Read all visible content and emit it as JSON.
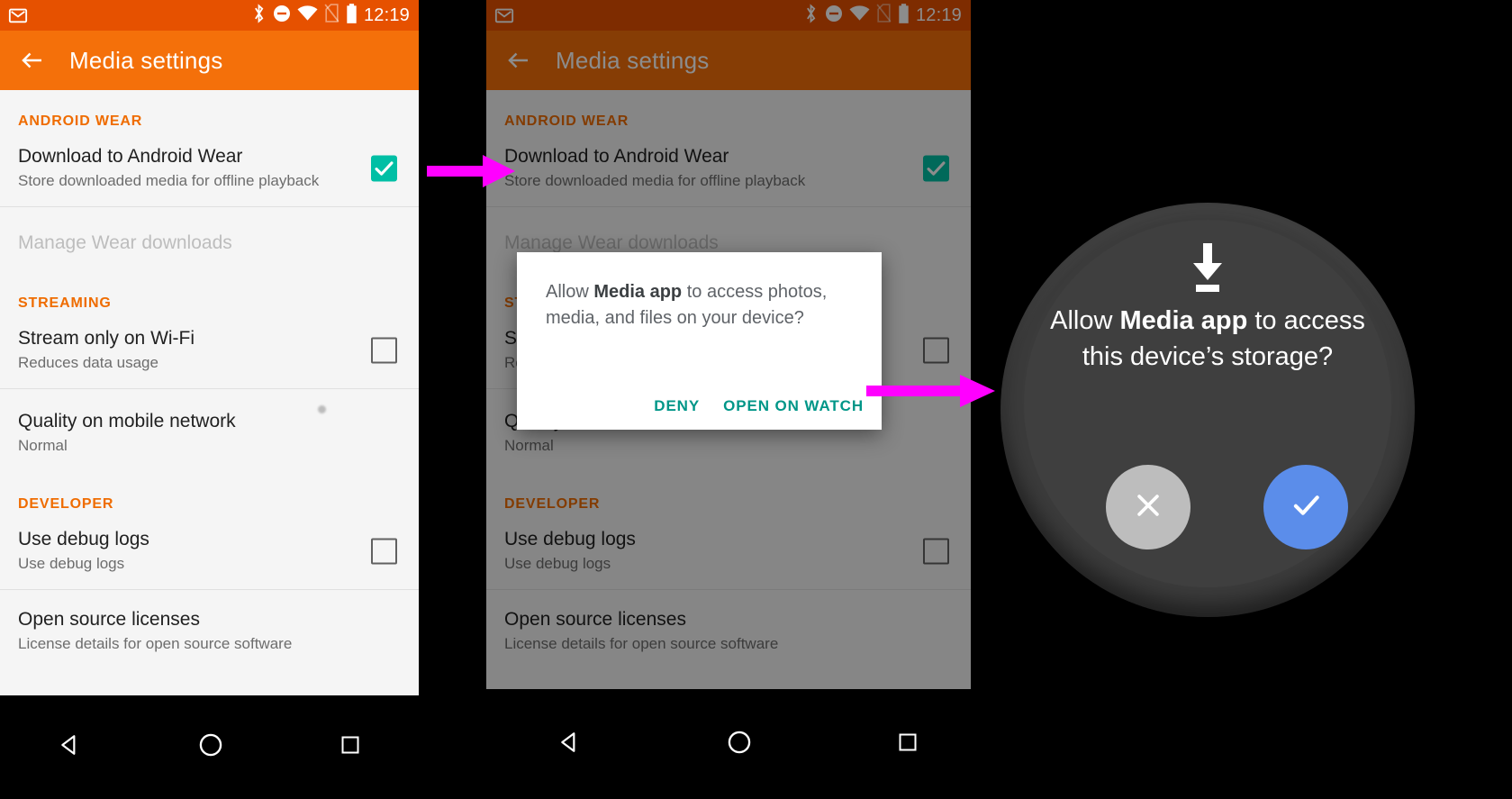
{
  "colors": {
    "status_bar": "#e65100",
    "app_bar": "#f4700a",
    "section_header": "#ef6c00",
    "checkbox_on": "#00bfa5",
    "dialog_action": "#009688",
    "arrow": "#ff00ff",
    "watch_allow": "#5b8dea",
    "watch_deny": "#bdbdbd"
  },
  "phone": {
    "status_bar": {
      "time": "12:19",
      "icons": [
        "gmail-icon",
        "bluetooth-icon",
        "do-not-disturb-icon",
        "wifi-icon",
        "no-sim-icon",
        "battery-icon"
      ]
    },
    "app_bar": {
      "back": "back-arrow-icon",
      "title": "Media settings"
    },
    "sections": [
      {
        "header": "ANDROID WEAR",
        "rows": [
          {
            "title": "Download to Android Wear",
            "subtitle": "Store downloaded media for offline playback",
            "control": "checkbox",
            "checked": true,
            "enabled": true
          },
          {
            "title": "Manage Wear downloads",
            "subtitle": "",
            "control": "none",
            "checked": false,
            "enabled": false
          }
        ]
      },
      {
        "header": "STREAMING",
        "rows": [
          {
            "title": "Stream only on Wi-Fi",
            "subtitle": "Reduces data usage",
            "control": "checkbox",
            "checked": false,
            "enabled": true
          },
          {
            "title": "Quality on mobile network",
            "subtitle": "Normal",
            "control": "none",
            "checked": false,
            "enabled": true
          }
        ]
      },
      {
        "header": "DEVELOPER",
        "rows": [
          {
            "title": "Use debug logs",
            "subtitle": "Use debug logs",
            "control": "checkbox",
            "checked": false,
            "enabled": true
          },
          {
            "title": "Open source licenses",
            "subtitle": "License details for open source software",
            "control": "none",
            "checked": false,
            "enabled": true
          }
        ]
      }
    ],
    "nav_bar": {
      "back": "nav-back-icon",
      "home": "nav-home-icon",
      "recents": "nav-recents-icon"
    }
  },
  "dialog": {
    "message_prefix": "Allow ",
    "message_app": "Media app",
    "message_suffix": " to access photos, media, and files on your device?",
    "deny_label": "DENY",
    "confirm_label": "OPEN ON WATCH"
  },
  "watch": {
    "icon": "download-icon",
    "message_prefix": "Allow ",
    "message_app": "Media app",
    "message_suffix": "  to access this device’s storage?",
    "deny": "close-icon",
    "allow": "check-icon"
  },
  "arrows": [
    {
      "name": "flow-arrow-1"
    },
    {
      "name": "flow-arrow-2"
    }
  ]
}
